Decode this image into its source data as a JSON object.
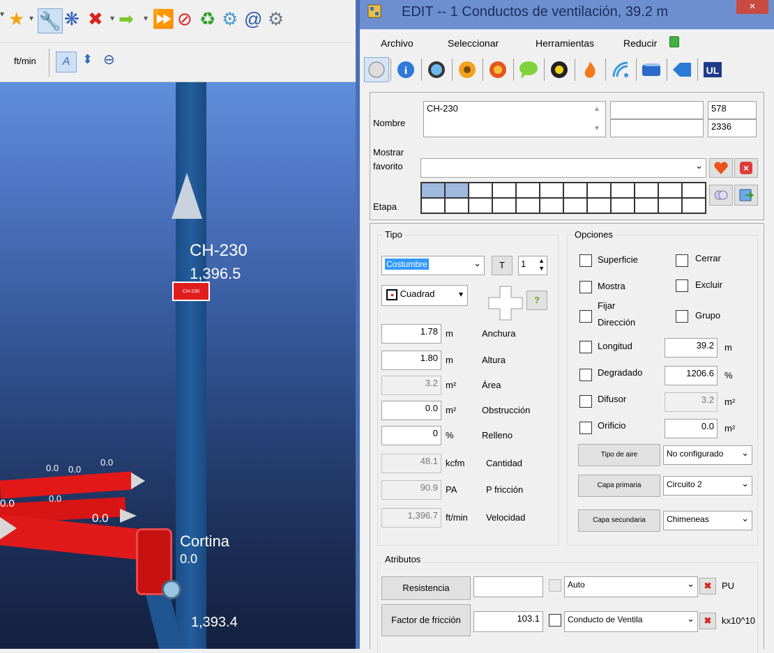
{
  "toolbar": {
    "units_label": "ft/min"
  },
  "viewport": {
    "airway_name": "CH-230",
    "airway_value": "1,396.5",
    "tag_label": "CH-230",
    "zero_labels": [
      "0.0",
      "0.0",
      "0.0",
      "0.0",
      "0.0",
      "0.0"
    ],
    "cortina_label": "Cortina",
    "cortina_value": "0.0",
    "bottom_value": "1,393.4"
  },
  "dialog": {
    "title": "EDIT -- 1 Conductos de ventilación, 39.2 m",
    "close": "×",
    "menu": [
      "Archivo",
      "Seleccionar",
      "Herramientas",
      "Reducir"
    ],
    "icons": [
      "globe-icon",
      "info-icon",
      "fan-icon",
      "radiation-icon",
      "fire-icon",
      "comment-icon",
      "nuclear-icon",
      "flame-icon",
      "signal-icon",
      "book-icon",
      "tag-icon",
      "ul-icon"
    ]
  },
  "name_section": {
    "nombre_label": "Nombre",
    "nombre_value": "CH-230",
    "id1": "578",
    "id2": "2336",
    "favorito_label": "Mostrar favorito",
    "favorito_value": "",
    "etapa_label": "Etapa"
  },
  "tipo": {
    "title": "Tipo",
    "type_value": "Costumbre",
    "t_button": "T",
    "count": "1",
    "shape_value": "Cuadrad",
    "help_button": "?",
    "rows": [
      {
        "value": "1.78",
        "unit": "m",
        "label": "Anchura",
        "readonly": false
      },
      {
        "value": "1.80",
        "unit": "m",
        "label": "Altura",
        "readonly": false
      },
      {
        "value": "3.2",
        "unit": "m²",
        "label": "Área",
        "readonly": true
      },
      {
        "value": "0.0",
        "unit": "m²",
        "label": "Obstrucción",
        "readonly": false
      },
      {
        "value": "0",
        "unit": "%",
        "label": "Relleno",
        "readonly": false
      },
      {
        "value": "48.1",
        "unit": "kcfm",
        "label": "Cantidad",
        "readonly": true
      },
      {
        "value": "90.9",
        "unit": "PA",
        "label": "P fricción",
        "readonly": true
      },
      {
        "value": "1,396.7",
        "unit": "ft/min",
        "label": "Velocidad",
        "readonly": true
      }
    ]
  },
  "opciones": {
    "title": "Opciones",
    "superficie": "Superficie",
    "cerrar": "Cerrar",
    "mostra": "Mostra",
    "excluir": "Excluir",
    "fijar": "Fijar",
    "direccion": "Dirección",
    "grupo": "Grupo",
    "longitud": "Longitud",
    "longitud_value": "39.2",
    "longitud_unit": "m",
    "degradado": "Degradado",
    "degradado_value": "1206.6",
    "degradado_unit": "%",
    "difusor": "Difusor",
    "difusor_value": "3.2",
    "difusor_unit": "m²",
    "orificio": "Orificio",
    "orificio_value": "0.0",
    "orificio_unit": "m²",
    "tipo_aire_btn": "Tipo de aire",
    "tipo_aire_value": "No configurado",
    "capa_primaria_btn": "Capa primaria",
    "capa_primaria_value": "Circuito 2",
    "capa_secundaria_btn": "Capa secundaria",
    "capa_secundaria_value": "Chimeneas"
  },
  "atributos": {
    "title": "Atributos",
    "resistencia_btn": "Resistencia",
    "resistencia_value": "",
    "resistencia_select": "Auto",
    "resistencia_unit": "PU",
    "factor_btn": "Factor de fricción",
    "factor_value": "103.1",
    "factor_select": "Conducto de Ventila",
    "factor_unit": "kx10^10"
  }
}
